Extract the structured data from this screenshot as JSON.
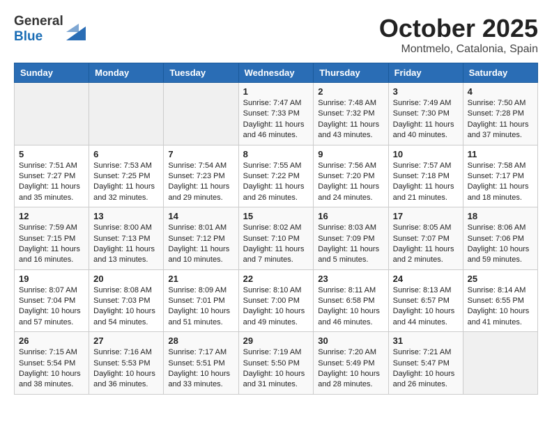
{
  "header": {
    "logo_line1": "General",
    "logo_line2": "Blue",
    "month": "October 2025",
    "location": "Montmelo, Catalonia, Spain"
  },
  "days_of_week": [
    "Sunday",
    "Monday",
    "Tuesday",
    "Wednesday",
    "Thursday",
    "Friday",
    "Saturday"
  ],
  "weeks": [
    [
      {
        "day": "",
        "sunrise": "",
        "sunset": "",
        "daylight": "",
        "empty": true
      },
      {
        "day": "",
        "sunrise": "",
        "sunset": "",
        "daylight": "",
        "empty": true
      },
      {
        "day": "",
        "sunrise": "",
        "sunset": "",
        "daylight": "",
        "empty": true
      },
      {
        "day": "1",
        "sunrise": "Sunrise: 7:47 AM",
        "sunset": "Sunset: 7:33 PM",
        "daylight": "Daylight: 11 hours and 46 minutes."
      },
      {
        "day": "2",
        "sunrise": "Sunrise: 7:48 AM",
        "sunset": "Sunset: 7:32 PM",
        "daylight": "Daylight: 11 hours and 43 minutes."
      },
      {
        "day": "3",
        "sunrise": "Sunrise: 7:49 AM",
        "sunset": "Sunset: 7:30 PM",
        "daylight": "Daylight: 11 hours and 40 minutes."
      },
      {
        "day": "4",
        "sunrise": "Sunrise: 7:50 AM",
        "sunset": "Sunset: 7:28 PM",
        "daylight": "Daylight: 11 hours and 37 minutes."
      }
    ],
    [
      {
        "day": "5",
        "sunrise": "Sunrise: 7:51 AM",
        "sunset": "Sunset: 7:27 PM",
        "daylight": "Daylight: 11 hours and 35 minutes."
      },
      {
        "day": "6",
        "sunrise": "Sunrise: 7:53 AM",
        "sunset": "Sunset: 7:25 PM",
        "daylight": "Daylight: 11 hours and 32 minutes."
      },
      {
        "day": "7",
        "sunrise": "Sunrise: 7:54 AM",
        "sunset": "Sunset: 7:23 PM",
        "daylight": "Daylight: 11 hours and 29 minutes."
      },
      {
        "day": "8",
        "sunrise": "Sunrise: 7:55 AM",
        "sunset": "Sunset: 7:22 PM",
        "daylight": "Daylight: 11 hours and 26 minutes."
      },
      {
        "day": "9",
        "sunrise": "Sunrise: 7:56 AM",
        "sunset": "Sunset: 7:20 PM",
        "daylight": "Daylight: 11 hours and 24 minutes."
      },
      {
        "day": "10",
        "sunrise": "Sunrise: 7:57 AM",
        "sunset": "Sunset: 7:18 PM",
        "daylight": "Daylight: 11 hours and 21 minutes."
      },
      {
        "day": "11",
        "sunrise": "Sunrise: 7:58 AM",
        "sunset": "Sunset: 7:17 PM",
        "daylight": "Daylight: 11 hours and 18 minutes."
      }
    ],
    [
      {
        "day": "12",
        "sunrise": "Sunrise: 7:59 AM",
        "sunset": "Sunset: 7:15 PM",
        "daylight": "Daylight: 11 hours and 16 minutes."
      },
      {
        "day": "13",
        "sunrise": "Sunrise: 8:00 AM",
        "sunset": "Sunset: 7:13 PM",
        "daylight": "Daylight: 11 hours and 13 minutes."
      },
      {
        "day": "14",
        "sunrise": "Sunrise: 8:01 AM",
        "sunset": "Sunset: 7:12 PM",
        "daylight": "Daylight: 11 hours and 10 minutes."
      },
      {
        "day": "15",
        "sunrise": "Sunrise: 8:02 AM",
        "sunset": "Sunset: 7:10 PM",
        "daylight": "Daylight: 11 hours and 7 minutes."
      },
      {
        "day": "16",
        "sunrise": "Sunrise: 8:03 AM",
        "sunset": "Sunset: 7:09 PM",
        "daylight": "Daylight: 11 hours and 5 minutes."
      },
      {
        "day": "17",
        "sunrise": "Sunrise: 8:05 AM",
        "sunset": "Sunset: 7:07 PM",
        "daylight": "Daylight: 11 hours and 2 minutes."
      },
      {
        "day": "18",
        "sunrise": "Sunrise: 8:06 AM",
        "sunset": "Sunset: 7:06 PM",
        "daylight": "Daylight: 10 hours and 59 minutes."
      }
    ],
    [
      {
        "day": "19",
        "sunrise": "Sunrise: 8:07 AM",
        "sunset": "Sunset: 7:04 PM",
        "daylight": "Daylight: 10 hours and 57 minutes."
      },
      {
        "day": "20",
        "sunrise": "Sunrise: 8:08 AM",
        "sunset": "Sunset: 7:03 PM",
        "daylight": "Daylight: 10 hours and 54 minutes."
      },
      {
        "day": "21",
        "sunrise": "Sunrise: 8:09 AM",
        "sunset": "Sunset: 7:01 PM",
        "daylight": "Daylight: 10 hours and 51 minutes."
      },
      {
        "day": "22",
        "sunrise": "Sunrise: 8:10 AM",
        "sunset": "Sunset: 7:00 PM",
        "daylight": "Daylight: 10 hours and 49 minutes."
      },
      {
        "day": "23",
        "sunrise": "Sunrise: 8:11 AM",
        "sunset": "Sunset: 6:58 PM",
        "daylight": "Daylight: 10 hours and 46 minutes."
      },
      {
        "day": "24",
        "sunrise": "Sunrise: 8:13 AM",
        "sunset": "Sunset: 6:57 PM",
        "daylight": "Daylight: 10 hours and 44 minutes."
      },
      {
        "day": "25",
        "sunrise": "Sunrise: 8:14 AM",
        "sunset": "Sunset: 6:55 PM",
        "daylight": "Daylight: 10 hours and 41 minutes."
      }
    ],
    [
      {
        "day": "26",
        "sunrise": "Sunrise: 7:15 AM",
        "sunset": "Sunset: 5:54 PM",
        "daylight": "Daylight: 10 hours and 38 minutes."
      },
      {
        "day": "27",
        "sunrise": "Sunrise: 7:16 AM",
        "sunset": "Sunset: 5:53 PM",
        "daylight": "Daylight: 10 hours and 36 minutes."
      },
      {
        "day": "28",
        "sunrise": "Sunrise: 7:17 AM",
        "sunset": "Sunset: 5:51 PM",
        "daylight": "Daylight: 10 hours and 33 minutes."
      },
      {
        "day": "29",
        "sunrise": "Sunrise: 7:19 AM",
        "sunset": "Sunset: 5:50 PM",
        "daylight": "Daylight: 10 hours and 31 minutes."
      },
      {
        "day": "30",
        "sunrise": "Sunrise: 7:20 AM",
        "sunset": "Sunset: 5:49 PM",
        "daylight": "Daylight: 10 hours and 28 minutes."
      },
      {
        "day": "31",
        "sunrise": "Sunrise: 7:21 AM",
        "sunset": "Sunset: 5:47 PM",
        "daylight": "Daylight: 10 hours and 26 minutes."
      },
      {
        "day": "",
        "sunrise": "",
        "sunset": "",
        "daylight": "",
        "empty": true
      }
    ]
  ]
}
